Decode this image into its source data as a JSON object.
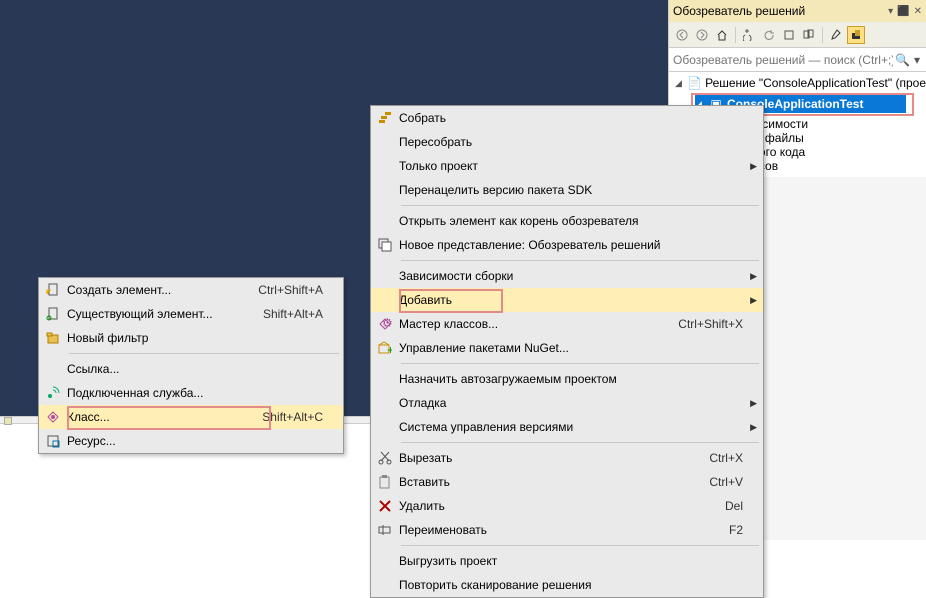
{
  "solution_explorer": {
    "title": "Обозреватель решений",
    "search_placeholder": "Обозреватель решений — поиск (Ctrl+;)",
    "solution_label": "Решение \"ConsoleApplicationTest\" (прое",
    "project_label": "ConsoleApplicationTest",
    "children": [
      "е зависимости",
      "очные файлы",
      "сходного кода",
      "ресурсов"
    ]
  },
  "main_menu": [
    {
      "label": "Собрать",
      "icon": "build"
    },
    {
      "label": "Пересобрать"
    },
    {
      "label": "Только проект",
      "arrow": true
    },
    {
      "label": "Перенацелить версию пакета SDK"
    },
    {
      "divider": true
    },
    {
      "label": "Открыть элемент как корень обозревателя"
    },
    {
      "label": "Новое представление: Обозреватель решений",
      "icon": "new-view"
    },
    {
      "divider": true
    },
    {
      "label": "Зависимости сборки",
      "arrow": true
    },
    {
      "label": "Добавить",
      "arrow": true,
      "hl": true,
      "hlbox": true
    },
    {
      "label": "Мастер классов...",
      "icon": "class-wiz",
      "shortcut": "Ctrl+Shift+X"
    },
    {
      "label": "Управление пакетами NuGet...",
      "icon": "nuget"
    },
    {
      "divider": true
    },
    {
      "label": "Назначить автозагружаемым проектом"
    },
    {
      "label": "Отладка",
      "arrow": true
    },
    {
      "label": "Система управления версиями",
      "arrow": true
    },
    {
      "divider": true
    },
    {
      "label": "Вырезать",
      "icon": "cut",
      "shortcut": "Ctrl+X"
    },
    {
      "label": "Вставить",
      "icon": "paste",
      "shortcut": "Ctrl+V"
    },
    {
      "label": "Удалить",
      "icon": "delete",
      "shortcut": "Del"
    },
    {
      "label": "Переименовать",
      "icon": "rename",
      "shortcut": "F2"
    },
    {
      "divider": true
    },
    {
      "label": "Выгрузить проект"
    },
    {
      "label": "Повторить сканирование решения"
    }
  ],
  "sub_menu": [
    {
      "label": "Создать элемент...",
      "icon": "new-item",
      "shortcut": "Ctrl+Shift+A"
    },
    {
      "label": "Существующий элемент...",
      "icon": "exist-item",
      "shortcut": "Shift+Alt+A"
    },
    {
      "label": "Новый фильтр",
      "icon": "new-filter"
    },
    {
      "divider": true
    },
    {
      "label": "Ссылка..."
    },
    {
      "label": "Подключенная служба...",
      "icon": "service"
    },
    {
      "label": "Класс...",
      "icon": "class",
      "shortcut": "Shift+Alt+C",
      "hl": true
    },
    {
      "label": "Ресурс...",
      "icon": "resource"
    }
  ]
}
